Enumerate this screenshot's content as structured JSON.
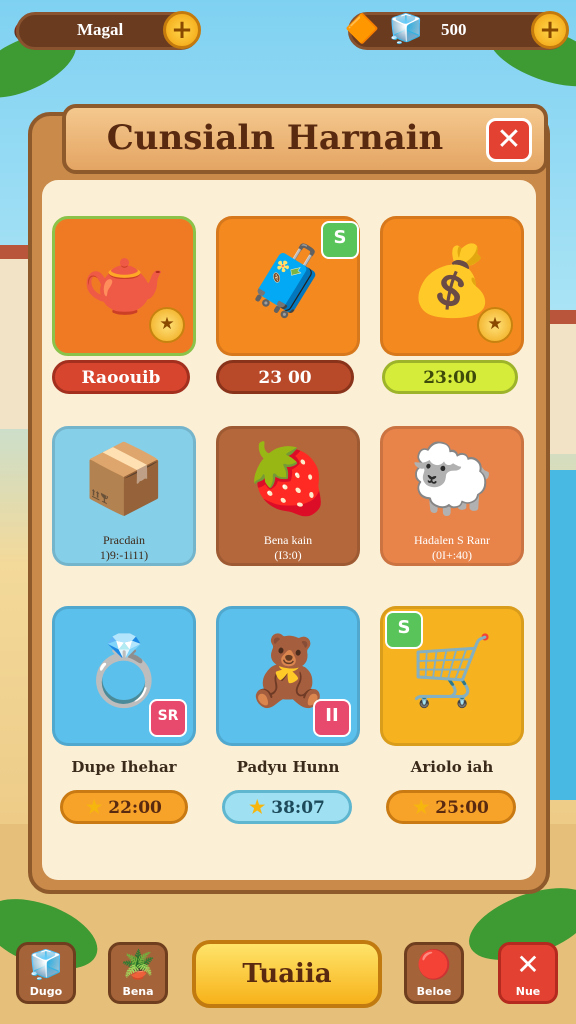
{
  "hud": {
    "left_value": "Magal",
    "right_value": "500",
    "plus_symbol": "+",
    "left_icon": "acorn-icon",
    "right_icons": [
      "gold-nugget-icon",
      "blue-gem-icon"
    ]
  },
  "dialog": {
    "title": "Cunsialn Harnain",
    "close_symbol": "✕"
  },
  "items": [
    {
      "name": "teapot-item",
      "price": "Raoouib",
      "icon": "teapot-icon"
    },
    {
      "name": "wooden-chest-item",
      "price": "23 00",
      "icon": "wooden-chest-icon",
      "badge": "S"
    },
    {
      "name": "gold-chest-item",
      "price": "23:00",
      "icon": "gold-chest-icon"
    },
    {
      "name": "blue-box-item",
      "line1": "Pracdain",
      "line2": "1)9:-1i11)",
      "icon": "blue-box-icon"
    },
    {
      "name": "fruit-basket-item",
      "line1": "Bena kain",
      "line2": "(I3:0)",
      "icon": "fruit-basket-icon"
    },
    {
      "name": "sheep-item",
      "line1": "Hadalen S Ranr",
      "line2": "(0I+:40)",
      "icon": "sheep-icon"
    },
    {
      "name": "ring-chest-item",
      "label": "Dupe Ihehar",
      "price": "22:00",
      "icon": "ring-chest-icon",
      "badge": "SR"
    },
    {
      "name": "bear-chest-item",
      "label": "Padyu Hunn",
      "price": "38:07",
      "icon": "bear-chest-icon",
      "badge": "II"
    },
    {
      "name": "cart-item",
      "label": "Ariolo iah",
      "price": "25:00",
      "icon": "cart-icon",
      "badge": "S"
    }
  ],
  "bottom_bar": {
    "left1_label": "Dugo",
    "left2_label": "Bena",
    "center_label": "Tuaiia",
    "right1_label": "Beloe",
    "right2_label": "Nue"
  },
  "colors": {
    "panel": "#c98a4a",
    "accent_gold": "#f7b21a",
    "close_red": "#e34232"
  }
}
